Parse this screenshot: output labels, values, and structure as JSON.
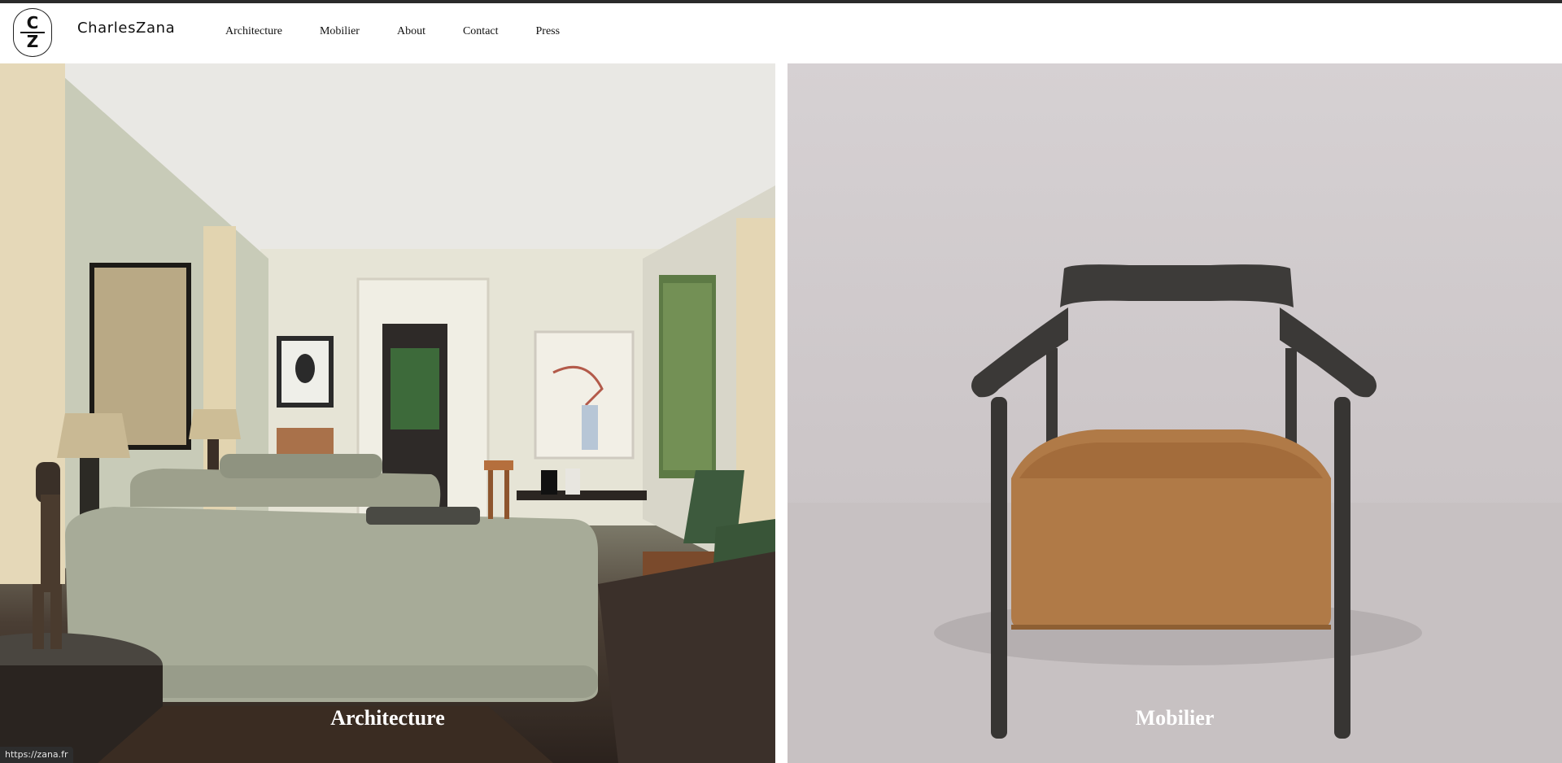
{
  "header": {
    "logo": {
      "top_letter": "C",
      "bottom_letter": "Z"
    },
    "brand": "CharlesZana",
    "nav": [
      "Architecture",
      "Mobilier",
      "About",
      "Contact",
      "Press"
    ]
  },
  "panels": {
    "architecture": {
      "title": "Architecture"
    },
    "mobilier": {
      "title": "Mobilier"
    }
  },
  "status_bar": {
    "url": "https://zana.fr"
  },
  "colors": {
    "top_strip": "#2b2b2b",
    "text": "#111111",
    "panel_title": "#ffffff"
  }
}
